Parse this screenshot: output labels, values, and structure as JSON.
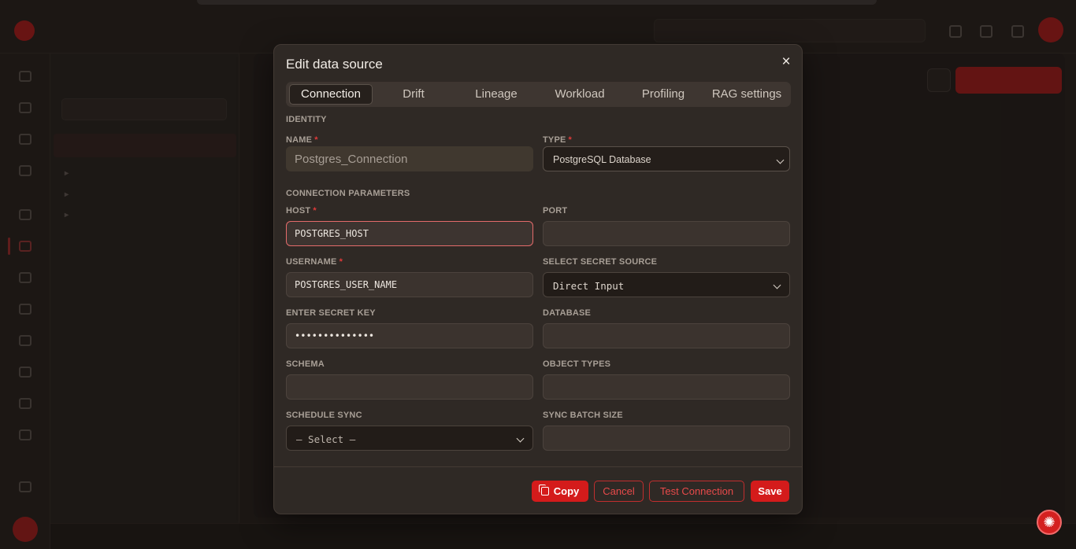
{
  "modal": {
    "title": "Edit data source",
    "close_label": "×",
    "tabs": [
      {
        "label": "Connection",
        "active": true
      },
      {
        "label": "Drift",
        "active": false
      },
      {
        "label": "Lineage",
        "active": false
      },
      {
        "label": "Workload",
        "active": false
      },
      {
        "label": "Profiling",
        "active": false
      },
      {
        "label": "RAG settings",
        "active": false
      }
    ],
    "identity_section": "IDENTITY",
    "name": {
      "label": "NAME",
      "required": "*",
      "value": "Postgres_Connection"
    },
    "type": {
      "label": "TYPE",
      "required": "*",
      "value": "PostgreSQL Database"
    },
    "connection_section": "CONNECTION PARAMETERS",
    "host": {
      "label": "HOST",
      "required": "*",
      "value": "POSTGRES_HOST"
    },
    "port": {
      "label": "PORT",
      "value": ""
    },
    "username": {
      "label": "USERNAME",
      "required": "*",
      "value": "POSTGRES_USER_NAME"
    },
    "secret_source": {
      "label": "SELECT SECRET SOURCE",
      "value": "Direct Input"
    },
    "secret_key": {
      "label": "ENTER SECRET KEY",
      "value": "••••••••••••••"
    },
    "database": {
      "label": "DATABASE",
      "value": ""
    },
    "schema": {
      "label": "SCHEMA",
      "value": ""
    },
    "object_types": {
      "label": "OBJECT TYPES",
      "value": ""
    },
    "schedule_sync": {
      "label": "SCHEDULE SYNC",
      "value": "— Select —"
    },
    "sync_batch_size": {
      "label": "SYNC BATCH SIZE",
      "value": ""
    },
    "footer": {
      "copy_label": "Copy",
      "cancel_label": "Cancel",
      "test_label": "Test Connection",
      "save_label": "Save"
    }
  },
  "colors": {
    "accent": "#d41b1b",
    "modal_bg": "#2f2925",
    "focus_border": "#e46b6b"
  }
}
